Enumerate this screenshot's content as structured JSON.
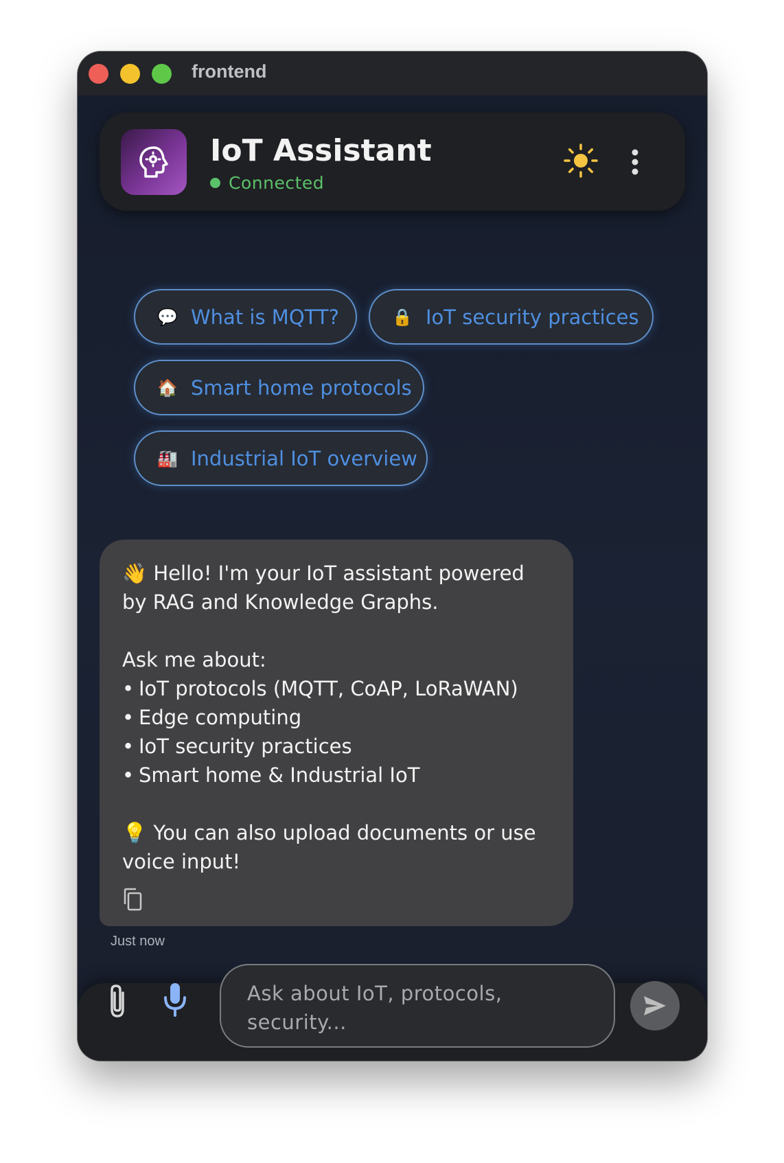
{
  "window": {
    "title": "frontend"
  },
  "header": {
    "title": "IoT Assistant",
    "status": "Connected",
    "status_color": "#5bc06a",
    "logo_icon": "brain-gear-icon",
    "theme_icon": "sun-icon",
    "menu_icon": "more-vertical-icon"
  },
  "suggestions": [
    {
      "emoji": "💬",
      "label": "What is MQTT?"
    },
    {
      "emoji": "🔒",
      "label": "IoT security practices"
    },
    {
      "emoji": "🏠",
      "label": "Smart home protocols"
    },
    {
      "emoji": "🏭",
      "label": "Industrial IoT overview"
    }
  ],
  "message": {
    "intro": "👋  Hello! I'm your IoT assistant powered by RAG and Knowledge Graphs.",
    "ask": "Ask me about:",
    "bullets": [
      "IoT protocols (MQTT, CoAP, LoRaWAN)",
      "Edge computing",
      "IoT security practices",
      "Smart home & Industrial IoT"
    ],
    "bullet_char": "•",
    "tip": "💡  You can also upload documents or use voice input!",
    "copy_icon": "copy-icon",
    "timestamp": "Just now"
  },
  "composer": {
    "placeholder": "Ask about IoT, protocols, security...",
    "attach_icon": "paperclip-icon",
    "mic_icon": "microphone-icon",
    "send_icon": "send-icon",
    "mic_color": "#8ab4f8"
  }
}
